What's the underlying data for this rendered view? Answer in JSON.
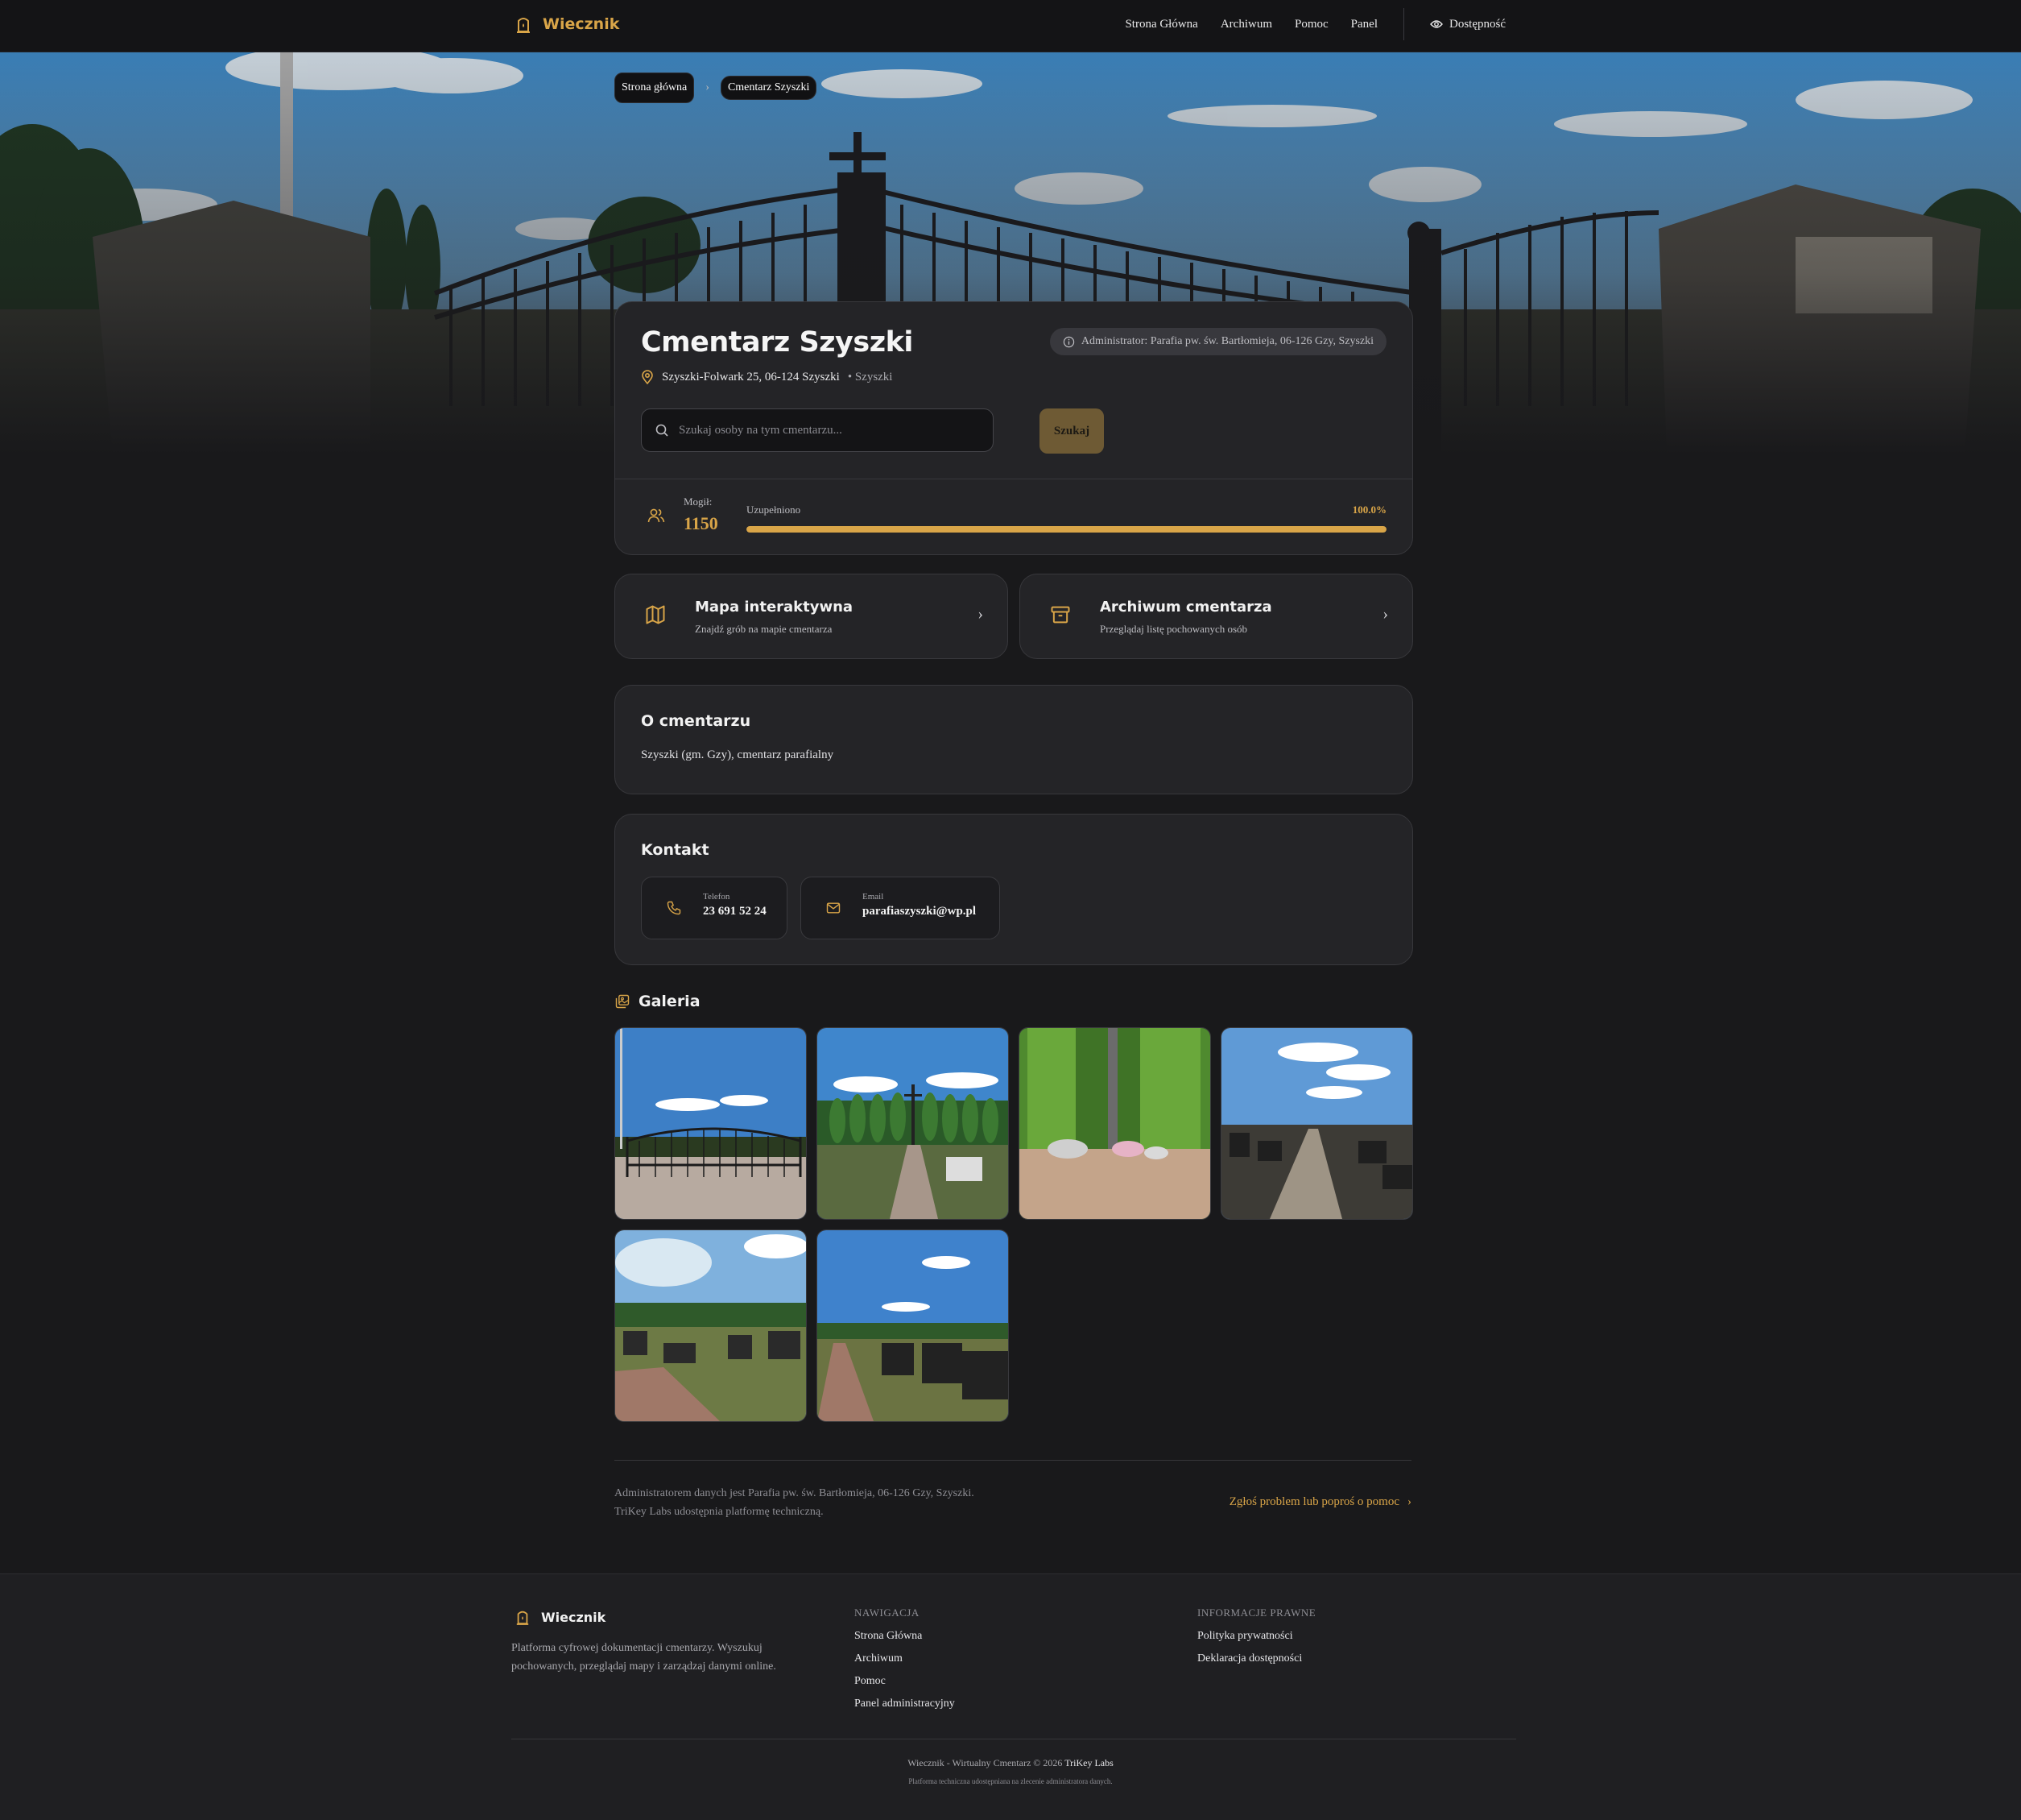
{
  "header": {
    "brand": "Wiecznik",
    "nav": [
      "Strona Główna",
      "Archiwum",
      "Pomoc",
      "Panel"
    ],
    "accessibility_label": "Dostępność"
  },
  "breadcrumb": {
    "home": "Strona główna",
    "current": "Cmentarz Szyszki"
  },
  "cemetery": {
    "name": "Cmentarz Szyszki",
    "admin": "Administrator: Parafia pw. św. Bartłomieja, 06-126 Gzy, Szyszki",
    "address": "Szyszki-Folwark 25, 06-124 Szyszki",
    "town": "• Szyszki",
    "search_placeholder": "Szukaj osoby na tym cmentarzu...",
    "search_button": "Szukaj",
    "graves_label": "Mogił:",
    "graves_count": "1150",
    "completion_label": "Uzupełniono",
    "completion_pct_text": "100.0%",
    "completion_fraction": 1.0
  },
  "links": [
    {
      "title": "Mapa interaktywna",
      "subtitle": "Znajdź grób na mapie cmentarza",
      "icon": "map-icon"
    },
    {
      "title": "Archiwum cmentarza",
      "subtitle": "Przeglądaj listę pochowanych osób",
      "icon": "archive-icon"
    }
  ],
  "about": {
    "title": "O cmentarzu",
    "text": "Szyszki (gm. Gzy), cmentarz parafialny"
  },
  "contact": {
    "title": "Kontakt",
    "phone_label": "Telefon",
    "phone": "23 691 52 24",
    "email_label": "Email",
    "email": "parafiaszyszki@wp.pl"
  },
  "gallery": {
    "title": "Galeria",
    "count": 6
  },
  "bottom_note": {
    "line1": "Administratorem danych jest Parafia pw. św. Bartłomieja, 06-126 Gzy, Szyszki.",
    "line2": "TriKey Labs udostępnia platformę techniczną.",
    "report": "Zgłoś problem lub poproś o pomoc"
  },
  "footer": {
    "brand": "Wiecznik",
    "desc": "Platforma cyfrowej dokumentacji cmentarzy. Wyszukuj pochowanych, przeglądaj mapy i zarządzaj danymi online.",
    "nav_heading": "NAWIGACJA",
    "nav_links": [
      "Strona Główna",
      "Archiwum",
      "Pomoc",
      "Panel administracyjny"
    ],
    "legal_heading": "INFORMACJE PRAWNE",
    "legal_links": [
      "Polityka prywatności",
      "Deklaracja dostępności"
    ],
    "copyright": "Wiecznik - Wirtualny Cmentarz © 2026",
    "copyright_company": "TriKey Labs",
    "subnote": "Platforma techniczna udostępniana na zlecenie administratora danych."
  },
  "colors": {
    "accent": "#d9a548",
    "background": "#19191b",
    "card": "#242427"
  }
}
